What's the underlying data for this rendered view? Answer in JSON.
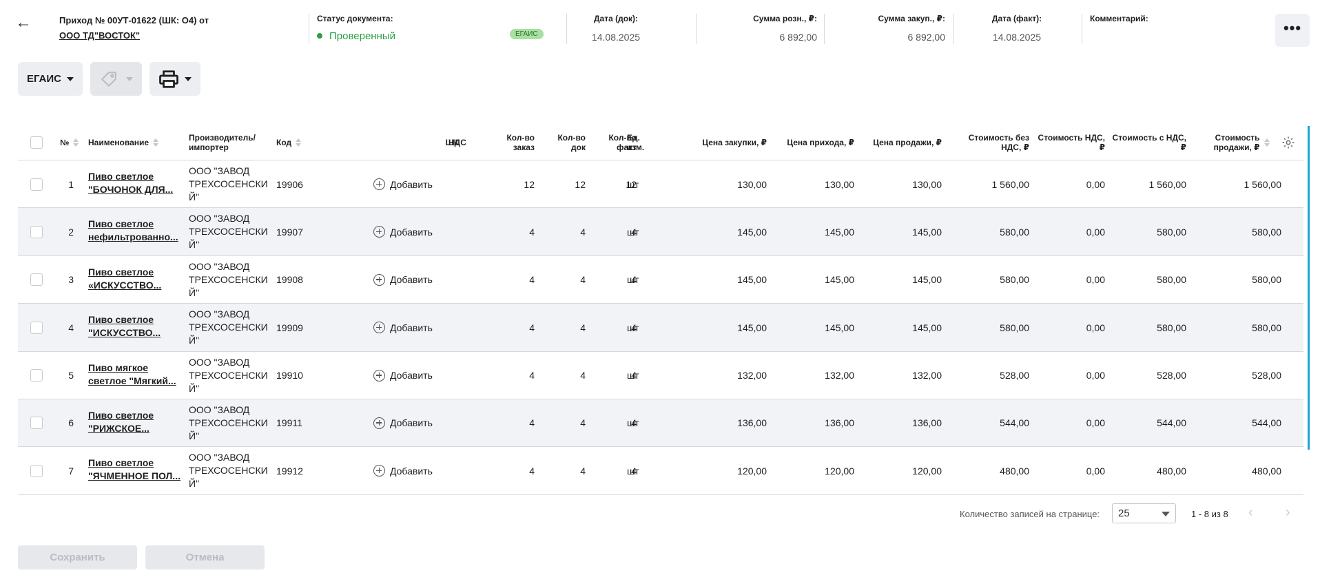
{
  "header": {
    "title": "Приход № 00УТ-01622 (ШК: О4) от",
    "supplier": "ООО ТД\"ВОСТОК\"",
    "status_label": "Статус документа:",
    "status_value": "Проверенный",
    "status_color": "#2e9e45",
    "badge": "ЕГАИС",
    "date_doc_label": "Дата (док):",
    "date_doc_value": "14.08.2025",
    "retail_sum_label": "Сумма розн., ₽:",
    "retail_sum_value": "6 892,00",
    "purchase_sum_label": "Сумма закуп., ₽:",
    "purchase_sum_value": "6 892,00",
    "date_fact_label": "Дата (факт):",
    "date_fact_value": "14.08.2025",
    "comment_label": "Комментарий:",
    "more_label": "•••"
  },
  "toolbar": {
    "egais_label": "ЕГАИС",
    "tag_icon": "tag-icon",
    "print_icon": "printer-icon"
  },
  "table": {
    "columns": {
      "num": "№",
      "name": "Наименование",
      "producer": "Производитель/ импортер",
      "code": "Код",
      "barcode": "ШК",
      "vat": "НДС",
      "qty_order": "Кол-во заказ",
      "qty_doc": "Кол-во док",
      "qty_fact": "Кол-во факт",
      "unit": "Ед. изм.",
      "price_purchase": "Цена закупки, ₽",
      "price_arrival": "Цена прихода, ₽",
      "price_sale": "Цена продажи, ₽",
      "cost_no_vat": "Стоимость без НДС, ₽",
      "cost_vat": "Стоимость НДС, ₽",
      "cost_with_vat": "Стоимость с НДС, ₽",
      "cost_sale": "Стоимость продажи, ₽"
    },
    "add_label": "Добавить",
    "rows": [
      {
        "num": "1",
        "name1": "Пиво светлое",
        "name2": "\"БОЧОНОК ДЛЯ...",
        "prod1": "ООО \"ЗАВОД",
        "prod2": "ТРЕХСОСЕНСКИ",
        "prod3": "Й\"",
        "code": "19906",
        "qty_order": "12",
        "qty_doc": "12",
        "qty_fact": "12",
        "unit": "шт",
        "price_purchase": "130,00",
        "price_arrival": "130,00",
        "price_sale": "130,00",
        "cost_no_vat": "1 560,00",
        "cost_vat": "0,00",
        "cost_with_vat": "1 560,00",
        "cost_sale": "1 560,00"
      },
      {
        "num": "2",
        "name1": "Пиво светлое",
        "name2": "нефильтрованно...",
        "prod1": "ООО \"ЗАВОД",
        "prod2": "ТРЕХСОСЕНСКИ",
        "prod3": "Й\"",
        "code": "19907",
        "qty_order": "4",
        "qty_doc": "4",
        "qty_fact": "4",
        "unit": "шт",
        "price_purchase": "145,00",
        "price_arrival": "145,00",
        "price_sale": "145,00",
        "cost_no_vat": "580,00",
        "cost_vat": "0,00",
        "cost_with_vat": "580,00",
        "cost_sale": "580,00"
      },
      {
        "num": "3",
        "name1": "Пиво светлое",
        "name2": "«ИСКУССТВО...",
        "prod1": "ООО \"ЗАВОД",
        "prod2": "ТРЕХСОСЕНСКИ",
        "prod3": "Й\"",
        "code": "19908",
        "qty_order": "4",
        "qty_doc": "4",
        "qty_fact": "4",
        "unit": "шт",
        "price_purchase": "145,00",
        "price_arrival": "145,00",
        "price_sale": "145,00",
        "cost_no_vat": "580,00",
        "cost_vat": "0,00",
        "cost_with_vat": "580,00",
        "cost_sale": "580,00"
      },
      {
        "num": "4",
        "name1": "Пиво светлое",
        "name2": "\"ИСКУССТВО...",
        "prod1": "ООО \"ЗАВОД",
        "prod2": "ТРЕХСОСЕНСКИ",
        "prod3": "Й\"",
        "code": "19909",
        "qty_order": "4",
        "qty_doc": "4",
        "qty_fact": "4",
        "unit": "шт",
        "price_purchase": "145,00",
        "price_arrival": "145,00",
        "price_sale": "145,00",
        "cost_no_vat": "580,00",
        "cost_vat": "0,00",
        "cost_with_vat": "580,00",
        "cost_sale": "580,00"
      },
      {
        "num": "5",
        "name1": "Пиво мягкое",
        "name2": "светлое \"Мягкий...",
        "prod1": "ООО \"ЗАВОД",
        "prod2": "ТРЕХСОСЕНСКИ",
        "prod3": "Й\"",
        "code": "19910",
        "qty_order": "4",
        "qty_doc": "4",
        "qty_fact": "4",
        "unit": "шт",
        "price_purchase": "132,00",
        "price_arrival": "132,00",
        "price_sale": "132,00",
        "cost_no_vat": "528,00",
        "cost_vat": "0,00",
        "cost_with_vat": "528,00",
        "cost_sale": "528,00"
      },
      {
        "num": "6",
        "name1": "Пиво светлое",
        "name2": "\"РИЖСКОЕ...",
        "prod1": "ООО \"ЗАВОД",
        "prod2": "ТРЕХСОСЕНСКИ",
        "prod3": "Й\"",
        "code": "19911",
        "qty_order": "4",
        "qty_doc": "4",
        "qty_fact": "4",
        "unit": "шт",
        "price_purchase": "136,00",
        "price_arrival": "136,00",
        "price_sale": "136,00",
        "cost_no_vat": "544,00",
        "cost_vat": "0,00",
        "cost_with_vat": "544,00",
        "cost_sale": "544,00"
      },
      {
        "num": "7",
        "name1": "Пиво светлое",
        "name2": "\"ЯЧМЕННОЕ ПОЛ...",
        "prod1": "ООО \"ЗАВОД",
        "prod2": "ТРЕХСОСЕНСКИ",
        "prod3": "Й\"",
        "code": "19912",
        "qty_order": "4",
        "qty_doc": "4",
        "qty_fact": "4",
        "unit": "шт",
        "price_purchase": "120,00",
        "price_arrival": "120,00",
        "price_sale": "120,00",
        "cost_no_vat": "480,00",
        "cost_vat": "0,00",
        "cost_with_vat": "480,00",
        "cost_sale": "480,00"
      }
    ]
  },
  "pagination": {
    "per_page_label": "Количество записей на странице:",
    "per_page_value": "25",
    "range": "1 - 8 из 8",
    "prev": "‹",
    "next": "›"
  },
  "footer": {
    "save_label": "Сохранить",
    "cancel_label": "Отмена"
  },
  "icons": {
    "back": "←"
  }
}
